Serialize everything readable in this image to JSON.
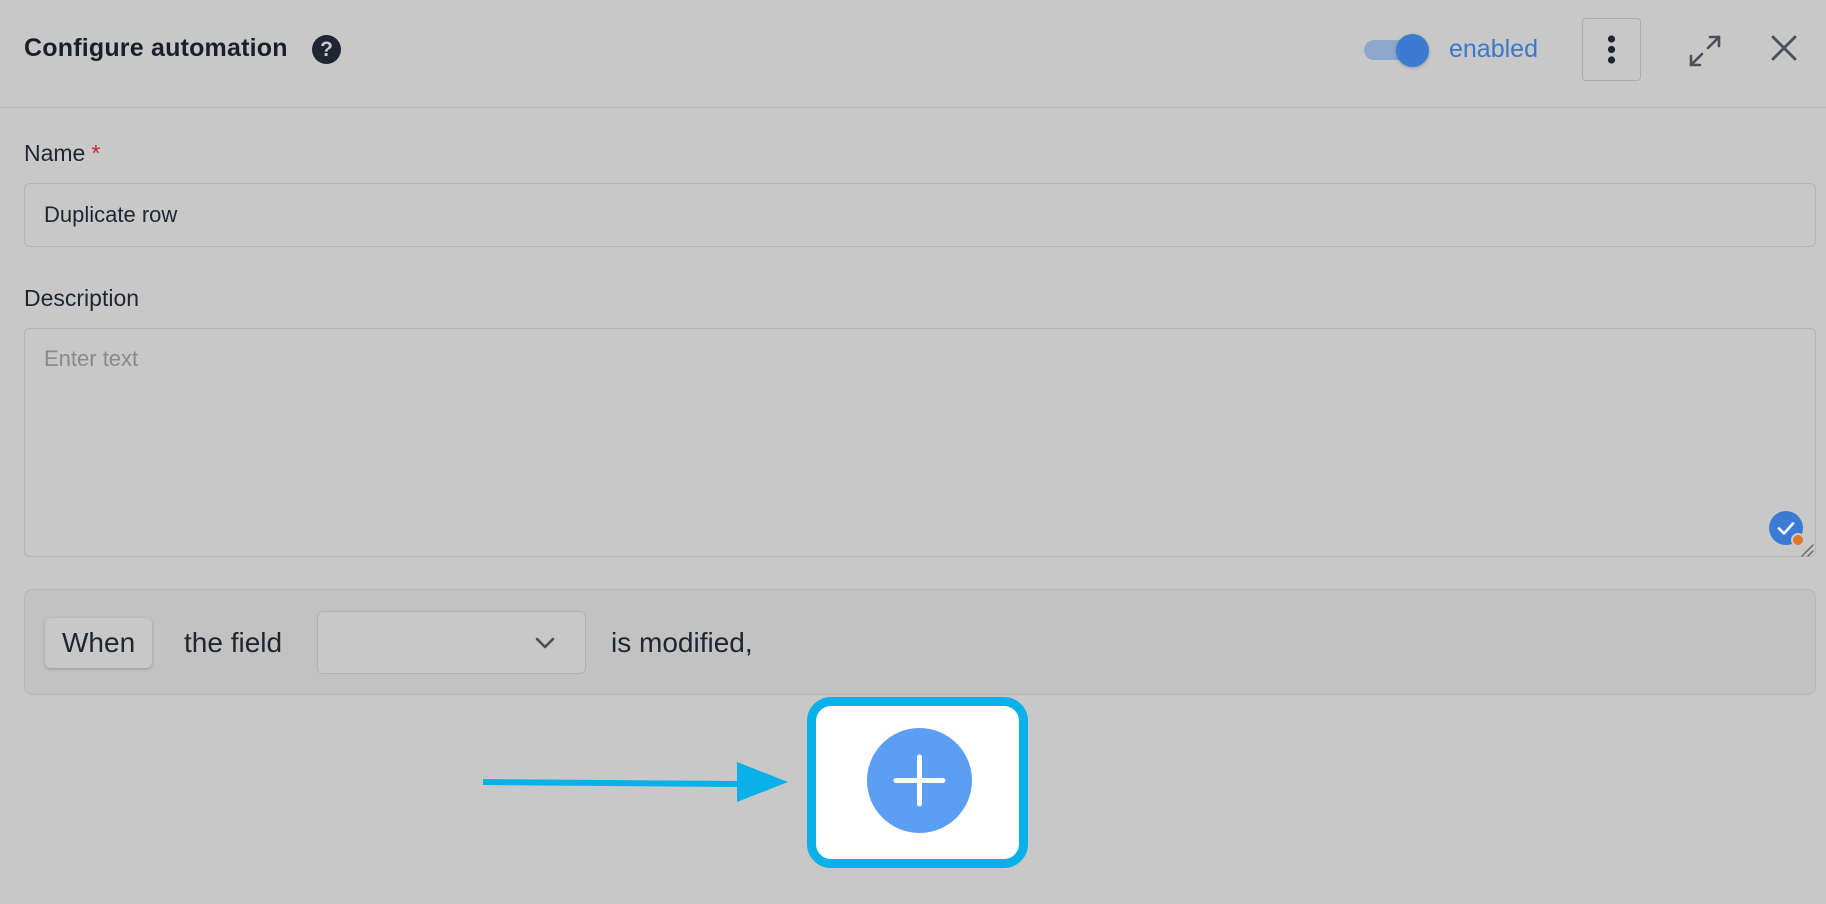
{
  "header": {
    "title": "Configure automation",
    "help_icon": "question-circle-icon",
    "status_label": "enabled",
    "toggle_on": true,
    "more_icon": "vertical-dots-icon",
    "expand_icon": "expand-icon",
    "close_icon": "close-icon"
  },
  "form": {
    "name_label": "Name",
    "required_mark": "*",
    "name_value": "Duplicate row",
    "description_label": "Description",
    "description_placeholder": "Enter text",
    "description_value": ""
  },
  "trigger": {
    "when_label": "When",
    "field_prefix": "the field",
    "field_value": "",
    "field_suffix": "is modified,"
  },
  "actions": {
    "add_icon": "plus-icon"
  },
  "colors": {
    "accent": "#3b7bd4",
    "add_button": "#5b9ef3",
    "highlight": "#0ab0e8",
    "required": "#c62828",
    "background": "#c8c8c8"
  }
}
